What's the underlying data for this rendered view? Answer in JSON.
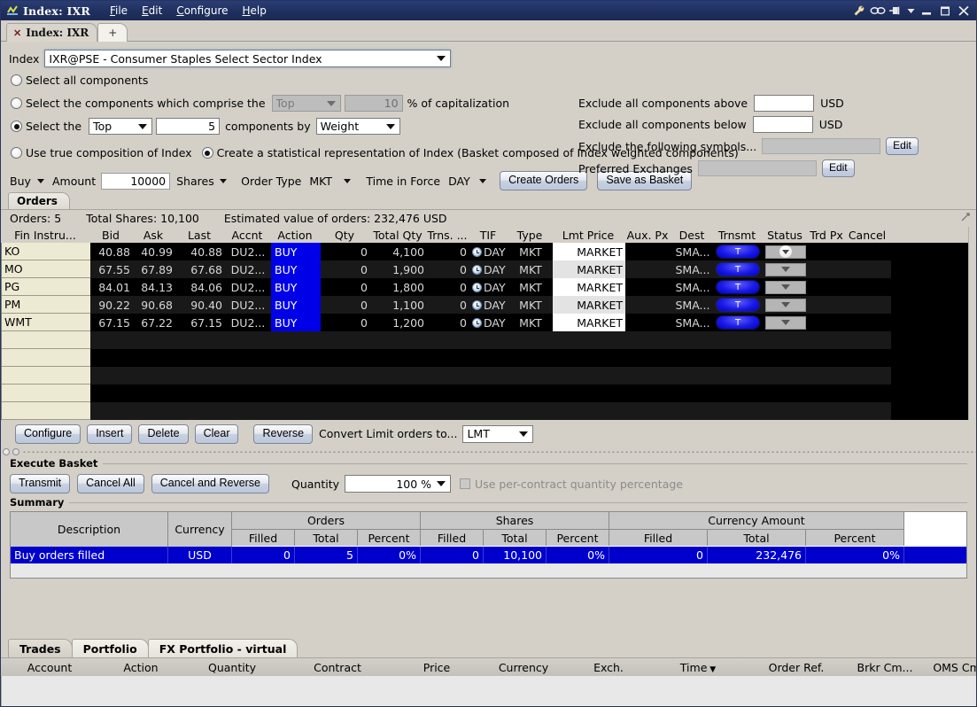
{
  "window": {
    "title": "Index: IXR",
    "app_icon": "chart-icon",
    "menus": [
      "File",
      "Edit",
      "Configure",
      "Help"
    ],
    "controls": [
      "wrench-icon",
      "link-icon",
      "pin-icon",
      "pin-dropdown-icon",
      "minimize-icon",
      "maximize-icon",
      "close-icon"
    ]
  },
  "tabs": {
    "doc_tab": "Index: IXR",
    "close_glyph": "✕",
    "add_tab": "+"
  },
  "index_selector": {
    "label": "Index",
    "value": "IXR@PSE - Consumer Staples Select Sector Index"
  },
  "selection": {
    "opt_all": "Select all components",
    "opt_comprise_pre": "Select the components which comprise the",
    "opt_comprise_mode": "Top",
    "opt_comprise_pct": "10",
    "opt_comprise_post": "% of capitalization",
    "opt_topn_pre": "Select the",
    "opt_topn_mode": "Top",
    "opt_topn_count": "5",
    "opt_topn_mid": "components by",
    "opt_topn_by": "Weight",
    "opt_true_composition": "Use true composition of Index",
    "opt_statistical": "Create a statistical representation of Index (Basket composed of Index weighted components)"
  },
  "filters": {
    "above_label": "Exclude all components above",
    "above_value": "",
    "above_unit": "USD",
    "below_label": "Exclude all components below",
    "below_value": "",
    "below_unit": "USD",
    "symbols_label": "Exclude the following symbols...",
    "symbols_value": "",
    "symbols_edit": "Edit",
    "exchanges_label": "Preferred Exchanges",
    "exchanges_value": "",
    "exchanges_edit": "Edit"
  },
  "order_entry": {
    "side": "Buy",
    "amount_label": "Amount",
    "amount_value": "10000",
    "amount_unit": "Shares",
    "order_type_label": "Order Type",
    "order_type": "MKT",
    "tif_label": "Time in Force",
    "tif": "DAY",
    "create_orders": "Create Orders",
    "save_as_basket": "Save as Basket"
  },
  "orders_panel": {
    "tab_label": "Orders",
    "count_label": "Orders: 5",
    "total_shares_label": "Total Shares: 10,100",
    "estimated_label": "Estimated value of orders: 232,476 USD",
    "columns": [
      "Fin Instru...",
      "Bid",
      "Ask",
      "Last",
      "Accnt",
      "Action",
      "Qty",
      "Total Qty",
      "Trns. ...",
      "TIF",
      "Type",
      "Lmt Price",
      "Aux. Px",
      "Dest",
      "Trnsmt",
      "Status",
      "Trd Px",
      "Cancel"
    ],
    "rows": [
      {
        "sym": "KO",
        "bid": "40.88",
        "ask": "40.99",
        "last": "40.88",
        "accnt": "DU2...",
        "action": "BUY",
        "qty": "0",
        "total_qty": "4,100",
        "trns": "0",
        "tif": "DAY",
        "type": "MKT",
        "lmt": "MARKET",
        "aux": "",
        "dest": "SMA...",
        "trnsmt": "T",
        "status": "",
        "trd": "",
        "cancel": ""
      },
      {
        "sym": "MO",
        "bid": "67.55",
        "ask": "67.89",
        "last": "67.68",
        "accnt": "DU2...",
        "action": "BUY",
        "qty": "0",
        "total_qty": "1,900",
        "trns": "0",
        "tif": "DAY",
        "type": "MKT",
        "lmt": "MARKET",
        "aux": "",
        "dest": "SMA...",
        "trnsmt": "T",
        "status": "",
        "trd": "",
        "cancel": ""
      },
      {
        "sym": "PG",
        "bid": "84.01",
        "ask": "84.13",
        "last": "84.06",
        "accnt": "DU2...",
        "action": "BUY",
        "qty": "0",
        "total_qty": "1,800",
        "trns": "0",
        "tif": "DAY",
        "type": "MKT",
        "lmt": "MARKET",
        "aux": "",
        "dest": "SMA...",
        "trnsmt": "T",
        "status": "",
        "trd": "",
        "cancel": ""
      },
      {
        "sym": "PM",
        "bid": "90.22",
        "ask": "90.68",
        "last": "90.40",
        "accnt": "DU2...",
        "action": "BUY",
        "qty": "0",
        "total_qty": "1,100",
        "trns": "0",
        "tif": "DAY",
        "type": "MKT",
        "lmt": "MARKET",
        "aux": "",
        "dest": "SMA...",
        "trnsmt": "T",
        "status": "",
        "trd": "",
        "cancel": ""
      },
      {
        "sym": "WMT",
        "bid": "67.15",
        "ask": "67.22",
        "last": "67.15",
        "accnt": "DU2...",
        "action": "BUY",
        "qty": "0",
        "total_qty": "1,200",
        "trns": "0",
        "tif": "DAY",
        "type": "MKT",
        "lmt": "MARKET",
        "aux": "",
        "dest": "SMA...",
        "trnsmt": "T",
        "status": "",
        "trd": "",
        "cancel": ""
      }
    ],
    "empty_rows": 5
  },
  "grid_toolbar": {
    "configure": "Configure",
    "insert": "Insert",
    "delete": "Delete",
    "clear": "Clear",
    "reverse": "Reverse",
    "convert_label": "Convert Limit orders to...",
    "convert_value": "LMT"
  },
  "execute_basket": {
    "group_label": "Execute Basket",
    "transmit": "Transmit",
    "cancel_all": "Cancel All",
    "cancel_and_reverse": "Cancel and Reverse",
    "quantity_label": "Quantity",
    "quantity_value": "100 %",
    "per_contract_label": "Use per-contract quantity percentage"
  },
  "summary": {
    "group_label": "Summary",
    "col_description": "Description",
    "col_currency": "Currency",
    "group_orders": "Orders",
    "group_shares": "Shares",
    "group_currency_amount": "Currency Amount",
    "sub_filled": "Filled",
    "sub_total": "Total",
    "sub_percent": "Percent",
    "rows": [
      {
        "description": "Buy orders filled",
        "currency": "USD",
        "orders_filled": "0",
        "orders_total": "5",
        "orders_percent": "0%",
        "shares_filled": "0",
        "shares_total": "10,100",
        "shares_percent": "0%",
        "amount_filled": "0",
        "amount_total": "232,476",
        "amount_percent": "0%"
      }
    ]
  },
  "bottom": {
    "tabs": [
      "Trades",
      "Portfolio",
      "FX Portfolio - virtual"
    ],
    "active_tab": "Trades",
    "columns": [
      "Account",
      "Action",
      "Quantity",
      "Contract",
      "Price",
      "Currency",
      "Exch.",
      "Time",
      "Order Ref.",
      "Brkr Cm...",
      "OMS Cm..."
    ],
    "sort_column": "Time",
    "sort_glyph": "▼"
  }
}
